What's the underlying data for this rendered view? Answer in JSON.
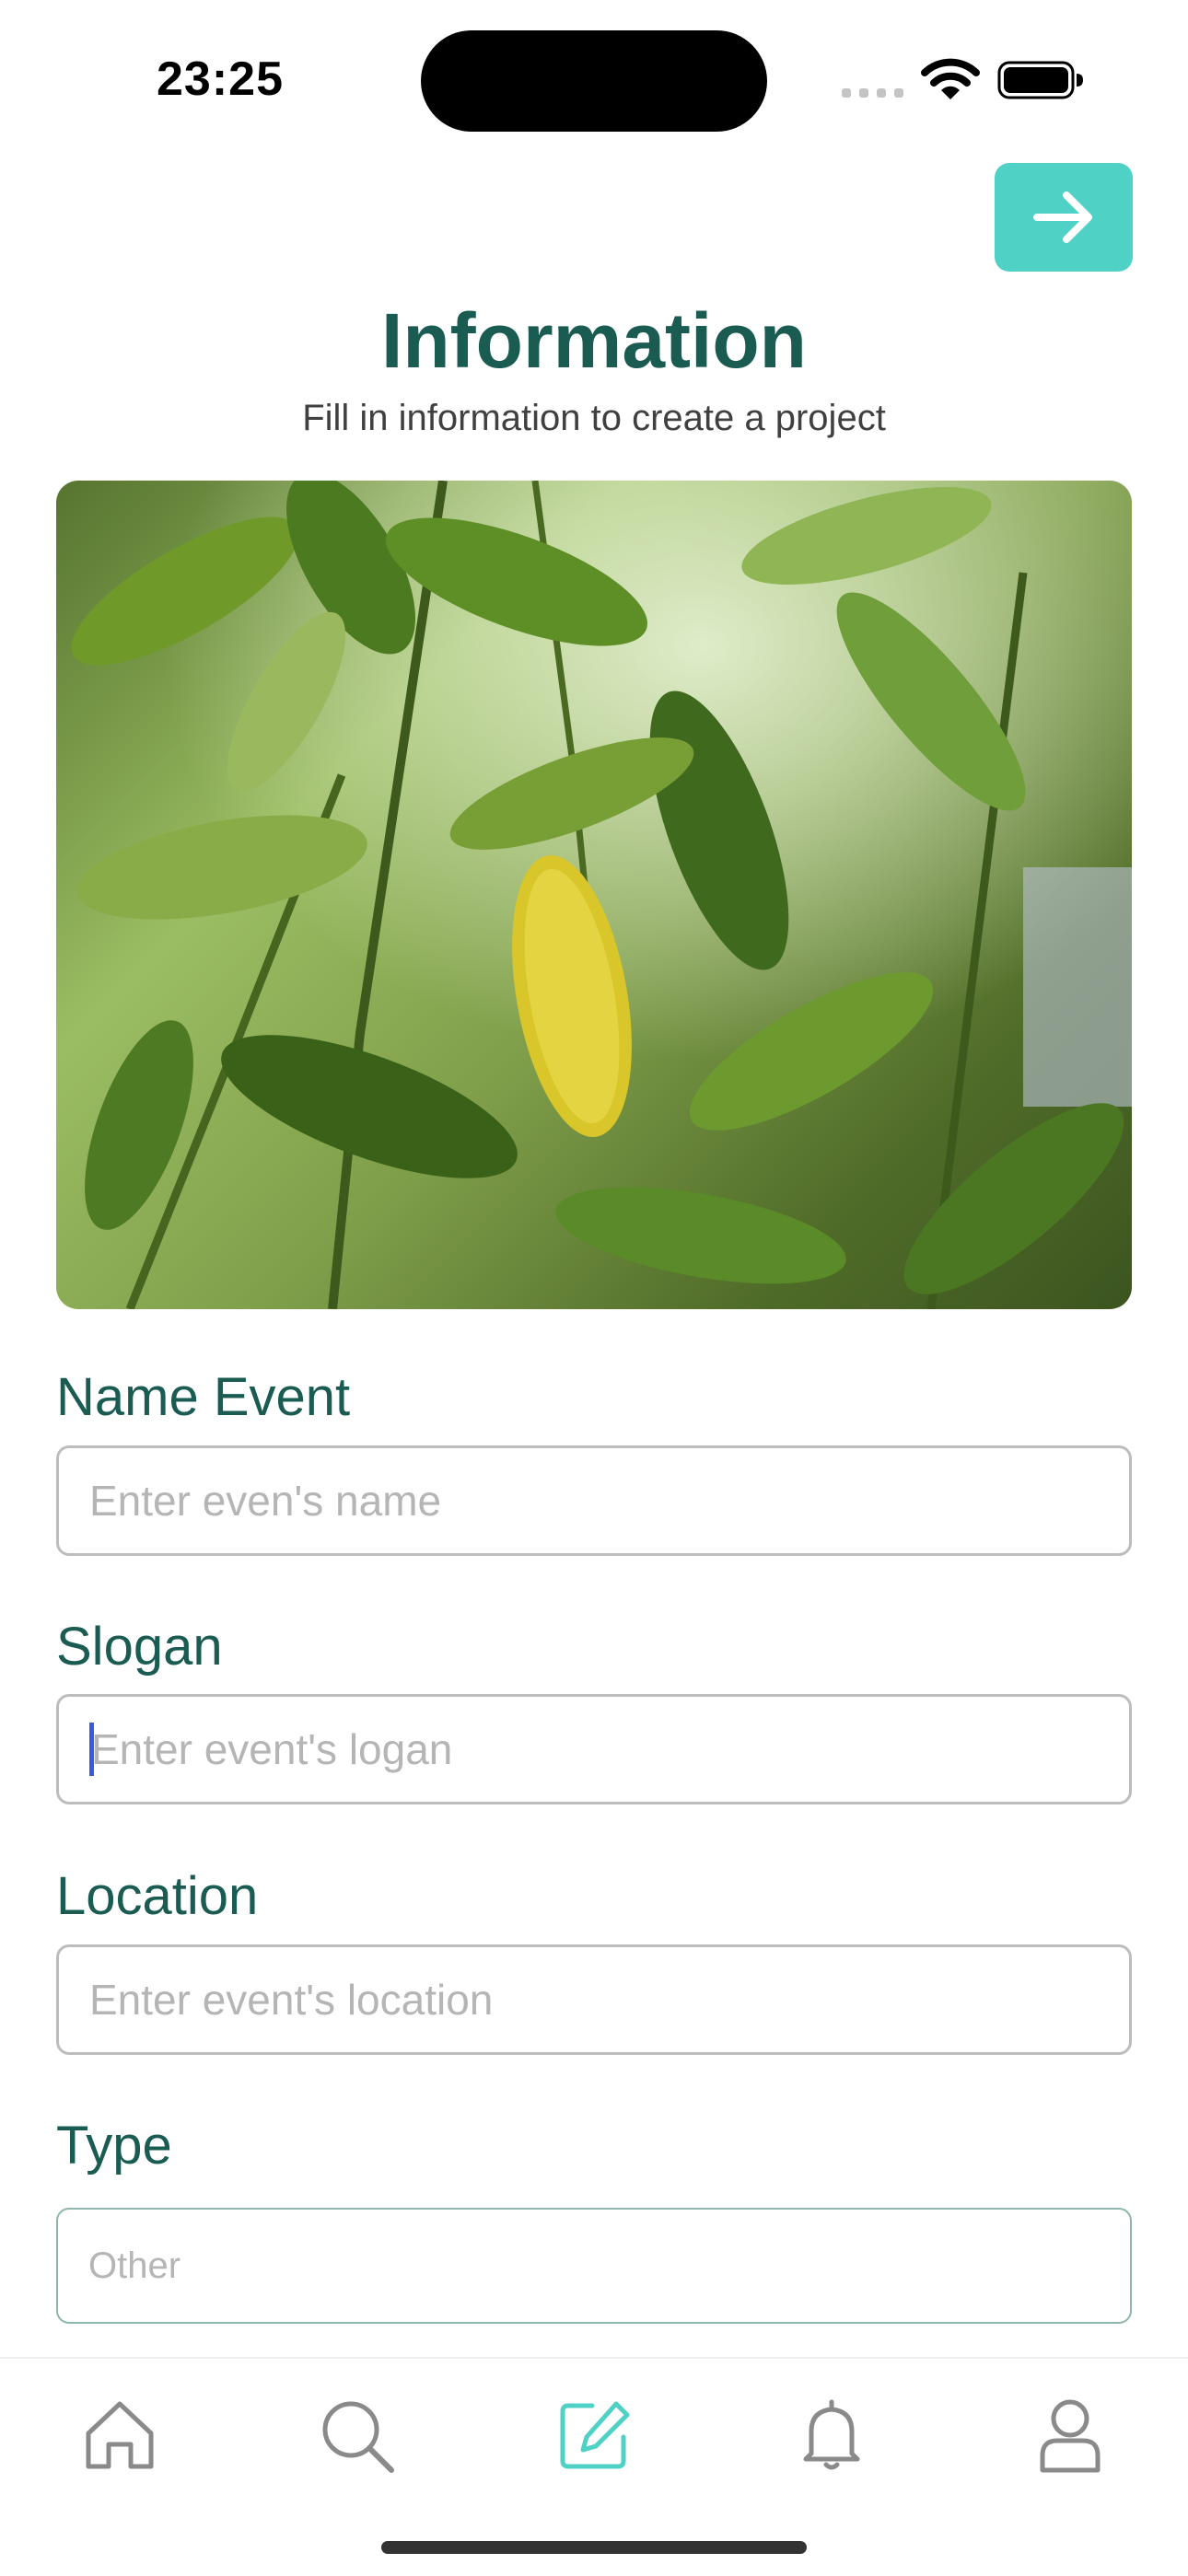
{
  "status_bar": {
    "time": "23:25"
  },
  "header": {
    "title": "Information",
    "subtitle": "Fill in information to create a project"
  },
  "form": {
    "name_event": {
      "label": "Name Event",
      "placeholder": "Enter even's name"
    },
    "slogan": {
      "label": "Slogan",
      "placeholder": "Enter event's logan"
    },
    "location": {
      "label": "Location",
      "placeholder": "Enter event's location"
    },
    "type": {
      "label": "Type",
      "value": "Other"
    }
  },
  "tabs": [
    {
      "icon": "home-icon",
      "active": false
    },
    {
      "icon": "search-icon",
      "active": false
    },
    {
      "icon": "edit-icon",
      "active": true
    },
    {
      "icon": "bell-icon",
      "active": false
    },
    {
      "icon": "profile-icon",
      "active": false
    }
  ],
  "colors": {
    "accent": "#4fd1c5",
    "heading": "#1a5b52",
    "tab_inactive": "#8a8a8a"
  }
}
